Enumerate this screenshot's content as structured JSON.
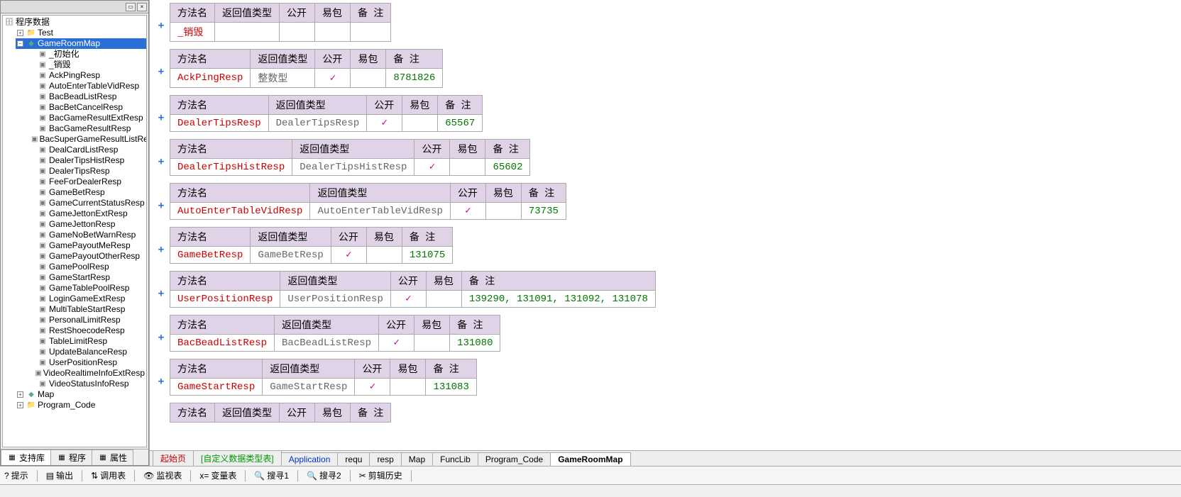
{
  "sidebar": {
    "root": "程序数据",
    "nodes": [
      {
        "label": "Test",
        "expandable": true,
        "expanded": false,
        "kind": "pkg"
      },
      {
        "label": "GameRoomMap",
        "expandable": true,
        "expanded": true,
        "selected": true,
        "kind": "cls",
        "children": [
          "_初始化",
          "_销毁",
          "AckPingResp",
          "AutoEnterTableVidResp",
          "BacBeadListResp",
          "BacBetCancelResp",
          "BacGameResultExtResp",
          "BacGameResultResp",
          "BacSuperGameResultListResp",
          "DealCardListResp",
          "DealerTipsHistResp",
          "DealerTipsResp",
          "FeeForDealerResp",
          "GameBetResp",
          "GameCurrentStatusResp",
          "GameJettonExtResp",
          "GameJettonResp",
          "GameNoBetWarnResp",
          "GamePayoutMeResp",
          "GamePayoutOtherResp",
          "GamePoolResp",
          "GameStartResp",
          "GameTablePoolResp",
          "LoginGameExtResp",
          "MultiTableStartResp",
          "PersonalLimitResp",
          "RestShoecodeResp",
          "TableLimitResp",
          "UpdateBalanceResp",
          "UserPositionResp",
          "VideoRealtimeInfoExtResp",
          "VideoStatusInfoResp"
        ]
      },
      {
        "label": "Map",
        "expandable": true,
        "expanded": false,
        "kind": "cls"
      },
      {
        "label": "Program_Code",
        "expandable": true,
        "expanded": false,
        "kind": "pkg"
      }
    ]
  },
  "sidebarTabs": [
    {
      "label": "支持库"
    },
    {
      "label": "程序"
    },
    {
      "label": "属性"
    }
  ],
  "cols": {
    "name": "方法名",
    "ret": "返回值类型",
    "pub": "公开",
    "pkg": "易包",
    "rem": "备 注"
  },
  "methods": [
    {
      "name": "_销毁",
      "ret": "",
      "pub": false,
      "pkg": "",
      "rem": ""
    },
    {
      "name": "AckPingResp",
      "ret": "整数型",
      "pub": true,
      "pkg": "",
      "rem": "8781826"
    },
    {
      "name": "DealerTipsResp",
      "ret": "DealerTipsResp",
      "pub": true,
      "pkg": "",
      "rem": "65567"
    },
    {
      "name": "DealerTipsHistResp",
      "ret": "DealerTipsHistResp",
      "pub": true,
      "pkg": "",
      "rem": "65602"
    },
    {
      "name": "AutoEnterTableVidResp",
      "ret": "AutoEnterTableVidResp",
      "pub": true,
      "pkg": "",
      "rem": "73735"
    },
    {
      "name": "GameBetResp",
      "ret": "GameBetResp",
      "pub": true,
      "pkg": "",
      "rem": "131075"
    },
    {
      "name": "UserPositionResp",
      "ret": "UserPositionResp",
      "pub": true,
      "pkg": "",
      "rem": "139290, 131091, 131092, 131078"
    },
    {
      "name": "BacBeadListResp",
      "ret": "BacBeadListResp",
      "pub": true,
      "pkg": "",
      "rem": "131080"
    },
    {
      "name": "GameStartResp",
      "ret": "GameStartResp",
      "pub": true,
      "pkg": "",
      "rem": "131083"
    }
  ],
  "nextHeader": {
    "name": "方法名",
    "ret": "返回值类型",
    "pub": "公开",
    "pkg": "易包",
    "rem": "备 注"
  },
  "editorTabs": [
    {
      "label": "起始页",
      "cls": "start"
    },
    {
      "label": "[自定义数据类型表]",
      "cls": "green"
    },
    {
      "label": "Application",
      "cls": "blue"
    },
    {
      "label": "requ",
      "cls": ""
    },
    {
      "label": "resp",
      "cls": ""
    },
    {
      "label": "Map",
      "cls": ""
    },
    {
      "label": "FuncLib",
      "cls": ""
    },
    {
      "label": "Program_Code",
      "cls": ""
    },
    {
      "label": "GameRoomMap",
      "cls": "active"
    }
  ],
  "toolbar": [
    {
      "label": "提示",
      "icon": "?"
    },
    {
      "label": "输出",
      "icon": "▤"
    },
    {
      "label": "调用表",
      "icon": "⇅"
    },
    {
      "label": "监视表",
      "icon": "👁"
    },
    {
      "label": "变量表",
      "icon": "x="
    },
    {
      "label": "搜寻1",
      "icon": "🔍"
    },
    {
      "label": "搜寻2",
      "icon": "🔍"
    },
    {
      "label": "剪辑历史",
      "icon": "✂"
    }
  ]
}
